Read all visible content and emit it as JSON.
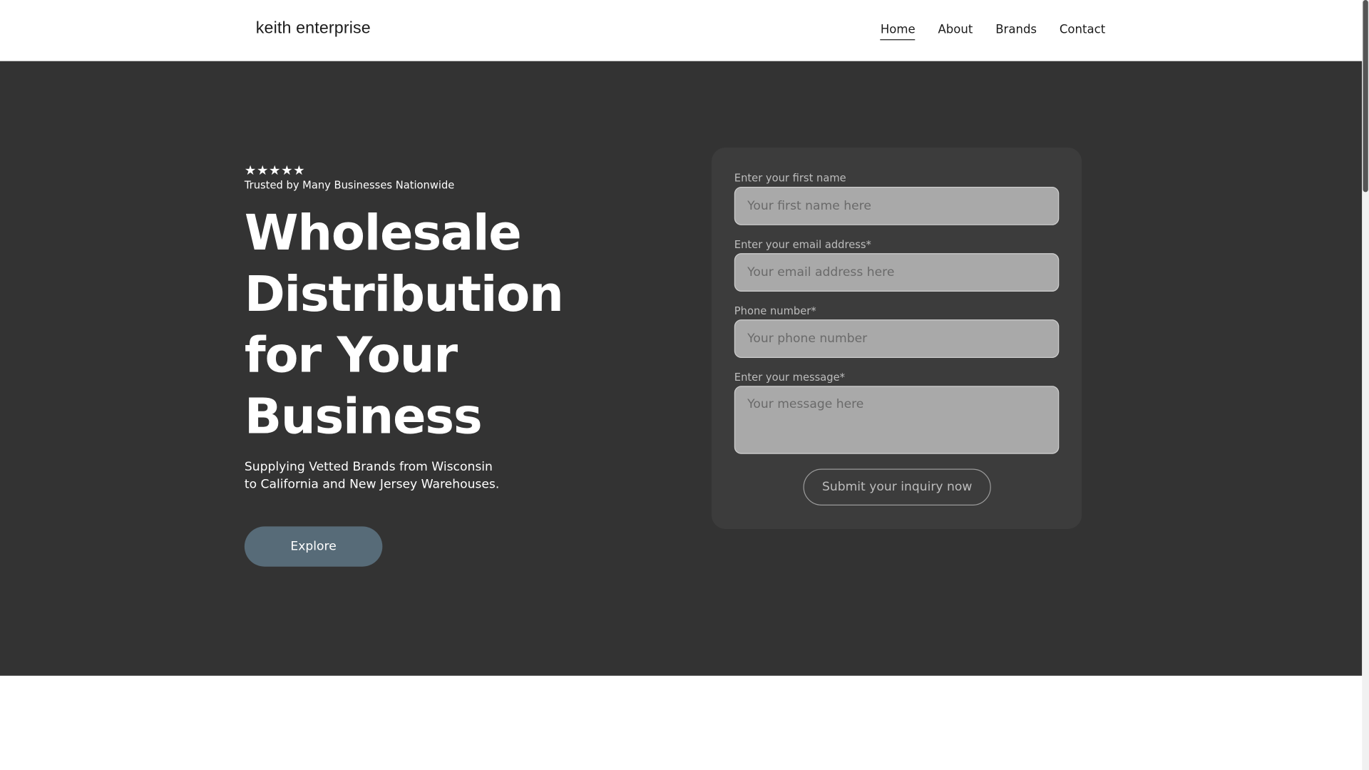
{
  "header": {
    "brand": "keith enterprise",
    "nav": [
      {
        "label": "Home",
        "active": true
      },
      {
        "label": "About",
        "active": false
      },
      {
        "label": "Brands",
        "active": false
      },
      {
        "label": "Contact",
        "active": false
      }
    ]
  },
  "hero": {
    "stars": "★★★★★",
    "rating": 5,
    "trusted_text": "Trusted by Many Businesses Nationwide",
    "headline": "Wholesale Distribution for Your Business",
    "subtitle": "Supplying Vetted Brands from Wisconsin to California and New Jersey Warehouses.",
    "explore_label": "Explore"
  },
  "form": {
    "first_name_label": "Enter your first name",
    "first_name_placeholder": "Your first name here",
    "email_label": "Enter your email address*",
    "email_placeholder": "Your email address here",
    "phone_label": "Phone number*",
    "phone_placeholder": "Your phone number",
    "message_label": "Enter your message*",
    "message_placeholder": "Your message here",
    "submit_label": "Submit your inquiry now"
  },
  "colors": {
    "hero_background": "#333333",
    "form_card": "#3c3c3c",
    "explore_button": "#576b78"
  }
}
